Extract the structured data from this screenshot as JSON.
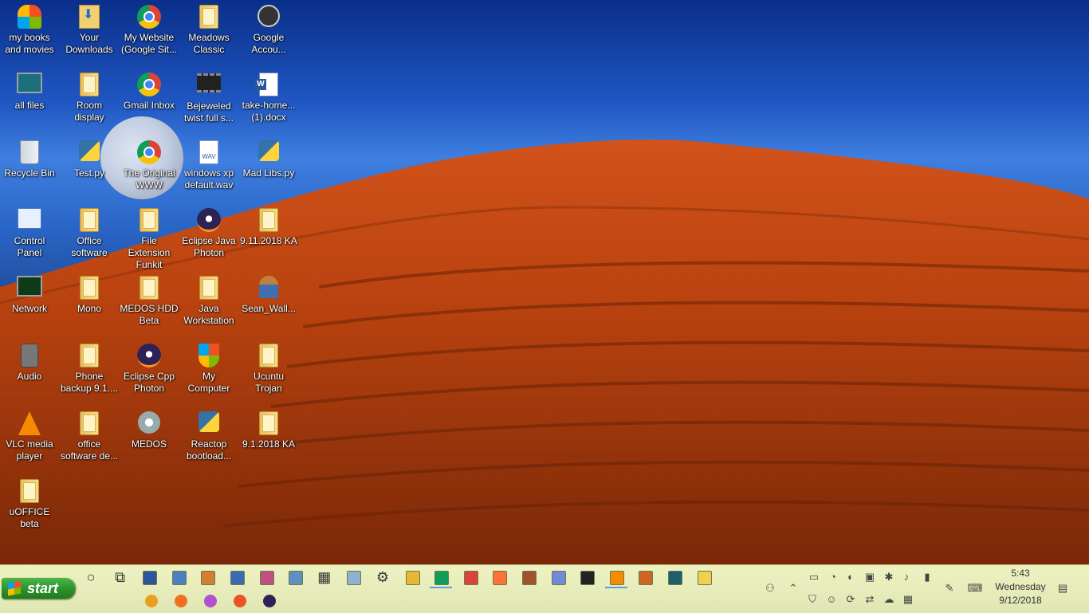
{
  "desktop": {
    "icons": [
      {
        "label": "my books\nand movies",
        "icon": "msn-butterfly-icon"
      },
      {
        "label": "Your\nDownloads",
        "icon": "downloads-folder-icon"
      },
      {
        "label": "My Website\n(Google Sit...",
        "icon": "chrome-icon"
      },
      {
        "label": "Meadows\nClassic",
        "icon": "folder-icon"
      },
      {
        "label": "Google\nAccou...",
        "icon": "clock-icon"
      },
      {
        "label": "all files",
        "icon": "computer-icon"
      },
      {
        "label": "Room\ndisplay",
        "icon": "folder-icon"
      },
      {
        "label": "Gmail Inbox",
        "icon": "chrome-icon"
      },
      {
        "label": "Bejeweled\ntwist full s...",
        "icon": "film-icon"
      },
      {
        "label": "take-home...\n(1).docx",
        "icon": "word-document-icon"
      },
      {
        "label": "Recycle Bin",
        "icon": "recycle-bin-icon"
      },
      {
        "label": "Test.py",
        "icon": "python-file-icon"
      },
      {
        "label": "The Original\nWWW",
        "icon": "chrome-icon"
      },
      {
        "label": "windows xp\ndefault.wav",
        "icon": "wav-file-icon"
      },
      {
        "label": "Mad Libs.py",
        "icon": "python-file-icon"
      },
      {
        "label": "Control\nPanel",
        "icon": "control-panel-icon"
      },
      {
        "label": "Office\nsoftware",
        "icon": "folder-icon"
      },
      {
        "label": "File Extension\nFunkit",
        "icon": "folder-icon"
      },
      {
        "label": "Eclipse Java\nPhoton",
        "icon": "eclipse-icon"
      },
      {
        "label": "9.11.2018 KA",
        "icon": "zip-folder-icon"
      },
      {
        "label": "Network",
        "icon": "network-icon"
      },
      {
        "label": "Mono",
        "icon": "folder-icon"
      },
      {
        "label": "MEDOS HDD\nBeta",
        "icon": "folder-icon"
      },
      {
        "label": "Java\nWorkstation",
        "icon": "folder-icon"
      },
      {
        "label": "Sean_Wall...",
        "icon": "user-folder-icon"
      },
      {
        "label": "Audio",
        "icon": "speaker-icon"
      },
      {
        "label": "Phone\nbackup 9.1....",
        "icon": "folder-icon"
      },
      {
        "label": "Eclipse Cpp\nPhoton",
        "icon": "eclipse-icon"
      },
      {
        "label": "My\nComputer",
        "icon": "windows-shield-icon"
      },
      {
        "label": "Ucuntu\nTrojan",
        "icon": "folder-icon"
      },
      {
        "label": "VLC media\nplayer",
        "icon": "vlc-icon"
      },
      {
        "label": "office\nsoftware de...",
        "icon": "folder-icon"
      },
      {
        "label": "MEDOS",
        "icon": "gear-disc-icon"
      },
      {
        "label": "Reactop\nbootload...",
        "icon": "python-file-icon"
      },
      {
        "label": "9.1.2018 KA",
        "icon": "zip-folder-icon"
      },
      {
        "label": "uOFFICE beta",
        "icon": "doc-folder-icon"
      }
    ]
  },
  "taskbar": {
    "start_label": "start",
    "row1": [
      "cortana-icon",
      "task-view-icon",
      "word-icon",
      "wordpad-icon",
      "paint-icon",
      "notepad-icon",
      "paint-3d-icon",
      "network-tool-icon",
      "calculator-icon",
      "notes-icon",
      "settings-icon",
      "file-explorer-icon",
      "chrome-icon",
      "chrome-alt-icon",
      "firefox-icon",
      "film-icon",
      "discord-icon",
      "terminal-icon",
      "vlc-icon",
      "app-icon",
      "book-icon",
      "sticky-notes-icon"
    ],
    "row2": [
      "audio-app-icon",
      "media-player-icon",
      "paint-balloon-icon",
      "ubuntu-icon",
      "eclipse-icon"
    ],
    "tray": {
      "time": "5:43",
      "day": "Wednesday",
      "date": "9/12/2018"
    }
  }
}
